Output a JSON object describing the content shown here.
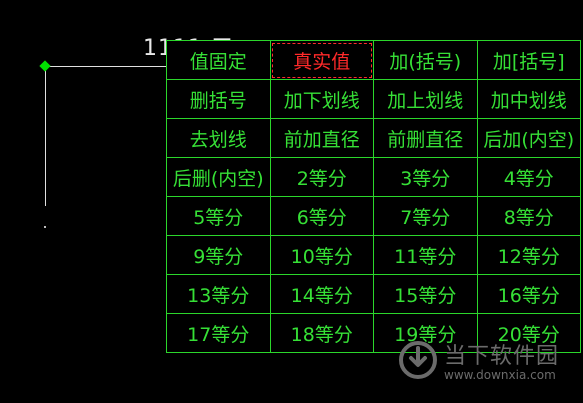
{
  "drawing": {
    "top_text": "1111 三"
  },
  "special_symbols_menu": {
    "colors": {
      "text": "#36e036",
      "border": "#2bd62b",
      "active": "#ff2a2a"
    },
    "rows": [
      [
        "值固定",
        "真实值",
        "加(括号)",
        "加[括号]"
      ],
      [
        "删括号",
        "加下划线",
        "加上划线",
        "加中划线"
      ],
      [
        "去划线",
        "前加直径",
        "前删直径",
        "后加(内空)"
      ],
      [
        "后删(内空)",
        "2等分",
        "3等分",
        "4等分"
      ],
      [
        "5等分",
        "6等分",
        "7等分",
        "8等分"
      ],
      [
        "9等分",
        "10等分",
        "11等分",
        "12等分"
      ],
      [
        "13等分",
        "14等分",
        "15等分",
        "16等分"
      ],
      [
        "17等分",
        "18等分",
        "19等分",
        "20等分"
      ]
    ],
    "active_item": "真实值"
  },
  "watermark": {
    "title": "当下软件园",
    "url": "www.downxia.com"
  }
}
